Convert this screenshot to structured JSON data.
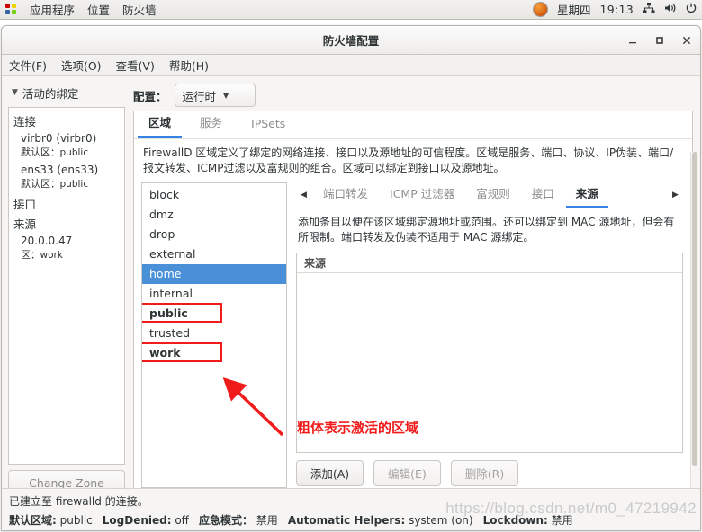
{
  "top_panel": {
    "apps_icon": "applications-icon",
    "items": [
      "应用程序",
      "位置",
      "防火墙"
    ],
    "status_icon": "orange-circle-icon",
    "day": "星期四",
    "time": "19:13",
    "tray": [
      "network-icon",
      "volume-icon",
      "power-icon"
    ]
  },
  "window": {
    "title": "防火墙配置",
    "buttons": {
      "minimize": "minimize-icon",
      "maximize": "maximize-icon",
      "close": "close-icon"
    },
    "menu": [
      "文件(F)",
      "选项(O)",
      "查看(V)",
      "帮助(H)"
    ]
  },
  "left_pane": {
    "header": "活动的绑定",
    "groups": [
      {
        "title": "连接",
        "entries": [
          {
            "name": "virbr0 (virbr0)",
            "label": "默认区",
            "value": "public"
          },
          {
            "name": "ens33 (ens33)",
            "label": "默认区",
            "value": "public"
          }
        ]
      },
      {
        "title": "接口",
        "entries": []
      },
      {
        "title": "来源",
        "entries": [
          {
            "name": "20.0.0.47",
            "label": "区",
            "value": "work"
          }
        ]
      }
    ],
    "change_zone_button": "Change Zone"
  },
  "config": {
    "label": "配置：",
    "selected": "运行时",
    "dropdown_icon": "chevron-down-icon"
  },
  "main_tabs": [
    {
      "label": "区域",
      "active": true
    },
    {
      "label": "服务",
      "active": false
    },
    {
      "label": "IPSets",
      "active": false
    }
  ],
  "zone_description": "FirewallD 区域定义了绑定的网络连接、接口以及源地址的可信程度。区域是服务、端口、协议、IP伪装、端口/报文转发、ICMP过滤以及富规则的组合。区域可以绑定到接口以及源地址。",
  "zones": [
    {
      "name": "block",
      "selected": false,
      "active": false,
      "highlighted": false
    },
    {
      "name": "dmz",
      "selected": false,
      "active": false,
      "highlighted": false
    },
    {
      "name": "drop",
      "selected": false,
      "active": false,
      "highlighted": false
    },
    {
      "name": "external",
      "selected": false,
      "active": false,
      "highlighted": false
    },
    {
      "name": "home",
      "selected": true,
      "active": false,
      "highlighted": false
    },
    {
      "name": "internal",
      "selected": false,
      "active": false,
      "highlighted": false
    },
    {
      "name": "public",
      "selected": false,
      "active": true,
      "highlighted": true
    },
    {
      "name": "trusted",
      "selected": false,
      "active": false,
      "highlighted": false
    },
    {
      "name": "work",
      "selected": false,
      "active": true,
      "highlighted": true
    }
  ],
  "sub_tabs": {
    "prev_icon": "chevron-left-icon",
    "next_icon": "chevron-right-icon",
    "tabs": [
      {
        "label": "端口转发",
        "active": false
      },
      {
        "label": "ICMP 过滤器",
        "active": false
      },
      {
        "label": "富规则",
        "active": false
      },
      {
        "label": "接口",
        "active": false
      },
      {
        "label": "来源",
        "active": true
      }
    ]
  },
  "source_panel": {
    "description": "添加条目以便在该区域绑定源地址或范围。还可以绑定到 MAC 源地址，但会有所限制。端口转发及伪装不适用于 MAC 源绑定。",
    "table_header": "来源",
    "rows": [],
    "buttons": [
      {
        "label": "添加(A)",
        "enabled": true
      },
      {
        "label": "编辑(E)",
        "enabled": false
      },
      {
        "label": "删除(R)",
        "enabled": false
      }
    ]
  },
  "annotations": {
    "note_text": "粗体表示激活的区域",
    "arrow": "red-arrow-icon",
    "color": "#f01c1c"
  },
  "status": {
    "connection_line": "已建立至 firewalld 的连接。",
    "fields": [
      {
        "key": "默认区域:",
        "value": "public"
      },
      {
        "key": "LogDenied:",
        "value": "off"
      },
      {
        "key": "应急模式：",
        "value": "禁用"
      },
      {
        "key": "Automatic Helpers:",
        "value": "system (on)"
      },
      {
        "key": "Lockdown:",
        "value": "禁用"
      }
    ]
  },
  "watermark": "https://blog.csdn.net/m0_47219942"
}
